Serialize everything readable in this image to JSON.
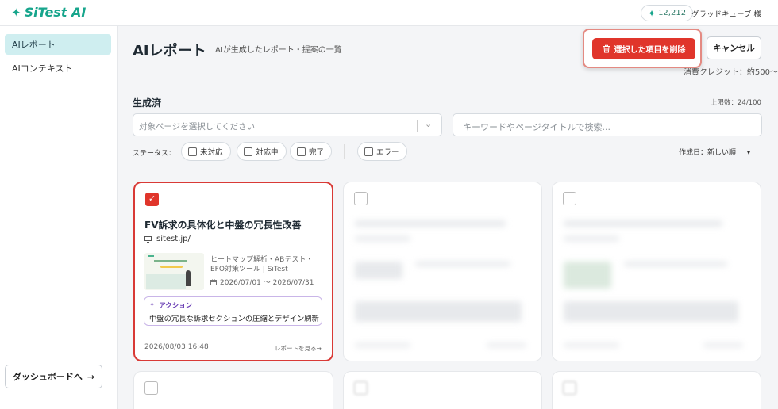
{
  "header": {
    "logo_text": "SiTest AI",
    "credits": "12,212",
    "user_name": "グラッドキューブ 様"
  },
  "sidebar": {
    "items": [
      {
        "label": "AIレポート",
        "active": true
      },
      {
        "label": "AIコンテキスト",
        "active": false
      }
    ],
    "dashboard_button": "ダッシュボードへ"
  },
  "main": {
    "title": "AIレポート",
    "subtitle": "AIが生成したレポート・提案の一覧",
    "delete_button": "選択した項目を削除",
    "cancel_button": "キャンセル",
    "credit_note": "消費クレジット：約500〜",
    "section_title": "生成済",
    "limit": "上限数：24/100",
    "page_select_placeholder": "対象ページを選択してください",
    "search_placeholder": "キーワードやページタイトルで検索...",
    "status_label": "ステータス：",
    "status_filters": [
      "未対応",
      "対応中",
      "完了",
      "エラー"
    ],
    "sort": "作成日：新しい順"
  },
  "cards": [
    {
      "selected": true,
      "title": "FV訴求の具体化と中盤の冗長性改善",
      "url": "sitest.jp/",
      "description": "ヒートマップ解析・ABテスト・EFO対策ツール | SiTest",
      "period": "2026/07/01 〜 2026/07/31",
      "action_label": "アクション",
      "action_text": "中盤の冗長な訴求セクションの圧縮とデザイン刷新",
      "created": "2026/08/03 16:48",
      "link": "レポートを見る→"
    }
  ],
  "colors": {
    "brand": "#17a58c",
    "danger": "#e0352b",
    "action": "#6a3fb5"
  }
}
